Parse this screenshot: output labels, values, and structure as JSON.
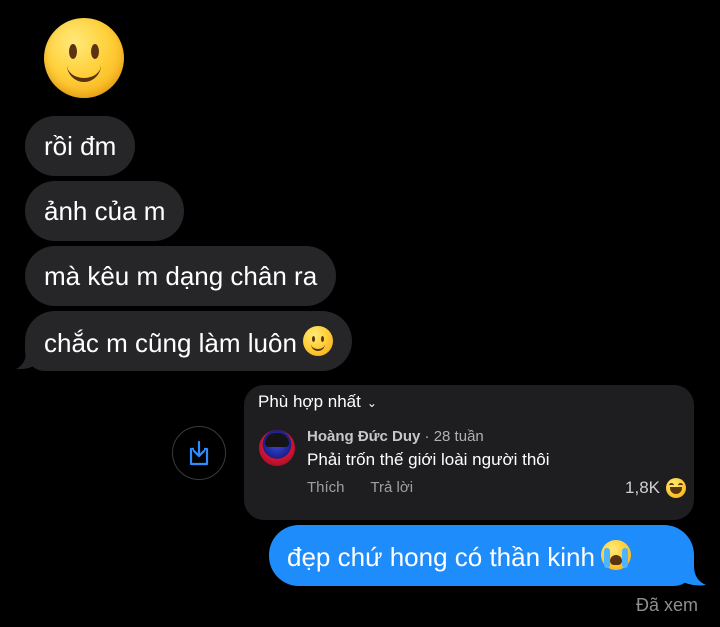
{
  "conversation": {
    "received": [
      {
        "text": "rồi đm"
      },
      {
        "text": "ảnh của m"
      },
      {
        "text": "mà kêu m dạng chân ra"
      },
      {
        "text": "chắc m cũng làm luôn"
      }
    ],
    "big_emoji": "slightly-smiling-face",
    "last_received_emoji": "slightly-smiling-face",
    "shared_comment": {
      "sort_label": "Phù hợp nhất",
      "author": "Hoàng Đức Duy",
      "age": "· 28 tuần",
      "text": "Phải trốn thế giới loài người thôi",
      "like_label": "Thích",
      "reply_label": "Trả lời",
      "like_count": "1,8K",
      "reaction_emoji": "grinning-squinting-face"
    },
    "sent": {
      "text": "đẹp chứ hong có thần kinh",
      "emoji": "loudly-crying-face",
      "color": "#1e8cfb"
    },
    "status": "Đã xem"
  }
}
